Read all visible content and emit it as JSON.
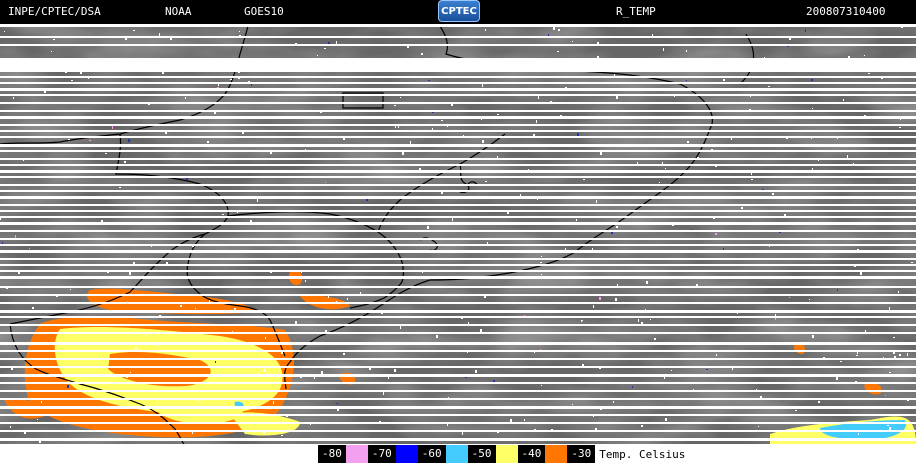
{
  "header": {
    "agency": "INPE/CPTEC/DSA",
    "source": "NOAA",
    "satellite": "GOES10",
    "logo": "CPTEC",
    "product": "R_TEMP",
    "timestamp": "200807310400"
  },
  "legend": {
    "items": [
      {
        "label": "-80",
        "color": "#f4a0f0"
      },
      {
        "label": "-70",
        "color": "#0000ff"
      },
      {
        "label": "-60",
        "color": "#44ccff"
      },
      {
        "label": "-50",
        "color": "#ffff66"
      },
      {
        "label": "-40",
        "color": "#ff7700"
      },
      {
        "label": "-30",
        "color": ""
      }
    ],
    "unit_label": "Temp. Celsius"
  },
  "colors": {
    "background": "#000000",
    "map_base": "#6a6a6a",
    "scanline": "#ffffff",
    "coastline": "#000000"
  }
}
